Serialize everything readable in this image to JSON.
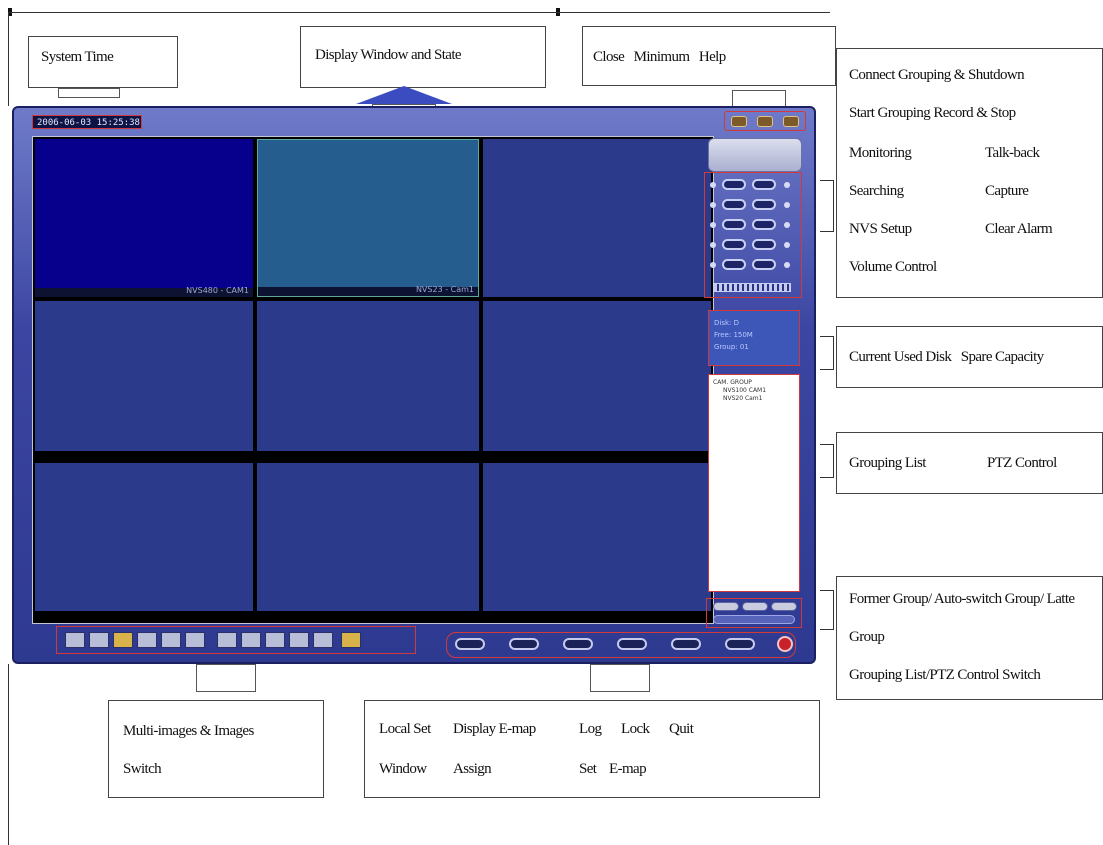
{
  "callouts": {
    "system_time": "System Time",
    "display_window": "Display Window and State",
    "close_min_help": "Close   Minimum   Help",
    "right_panel": {
      "line1": "Connect Grouping & Shutdown",
      "line2": "Start Grouping Record & Stop",
      "line3a": "Monitoring",
      "line3b": "Talk-back",
      "line4a": "Searching",
      "line4b": "Capture",
      "line5a": "NVS Setup",
      "line5b": "Clear Alarm",
      "line6": "Volume Control"
    },
    "disk": "Current Used Disk   Spare Capacity",
    "grouping": {
      "a": "Grouping List",
      "b": "PTZ Control"
    },
    "former_group": {
      "line1": "Former Group/ Auto-switch Group/ Latte",
      "line2": "Group",
      "line3": "Grouping List/PTZ Control Switch"
    },
    "multi_images": {
      "line1": "Multi-images & Images",
      "line2": "Switch"
    },
    "toolbar": {
      "row1": [
        "Local Set",
        "Display E-map",
        "Log",
        "Lock",
        "Quit"
      ],
      "row2": [
        "Window",
        "Assign",
        "Set",
        "E-map"
      ]
    }
  },
  "app": {
    "system_time_value": "2006-06-03 15:25:38",
    "tiles": [
      {
        "caption": "NVS480 - CAM1"
      },
      {
        "caption": "NVS23 - Cam1"
      },
      {
        "caption": ""
      },
      {
        "caption": ""
      },
      {
        "caption": ""
      },
      {
        "caption": ""
      },
      {
        "caption": ""
      },
      {
        "caption": ""
      },
      {
        "caption": ""
      }
    ],
    "disk_info": {
      "disk": "Disk: D",
      "free": "Free: 150M",
      "group": "Group: 01"
    },
    "group_list": [
      "CAM. GROUP",
      "NVS100 CAM1",
      "NVS20 Cam1"
    ]
  },
  "colors": {
    "window": "#3c46a2",
    "highlight": "#d13a3a",
    "arrow": "#3b4cc0"
  }
}
